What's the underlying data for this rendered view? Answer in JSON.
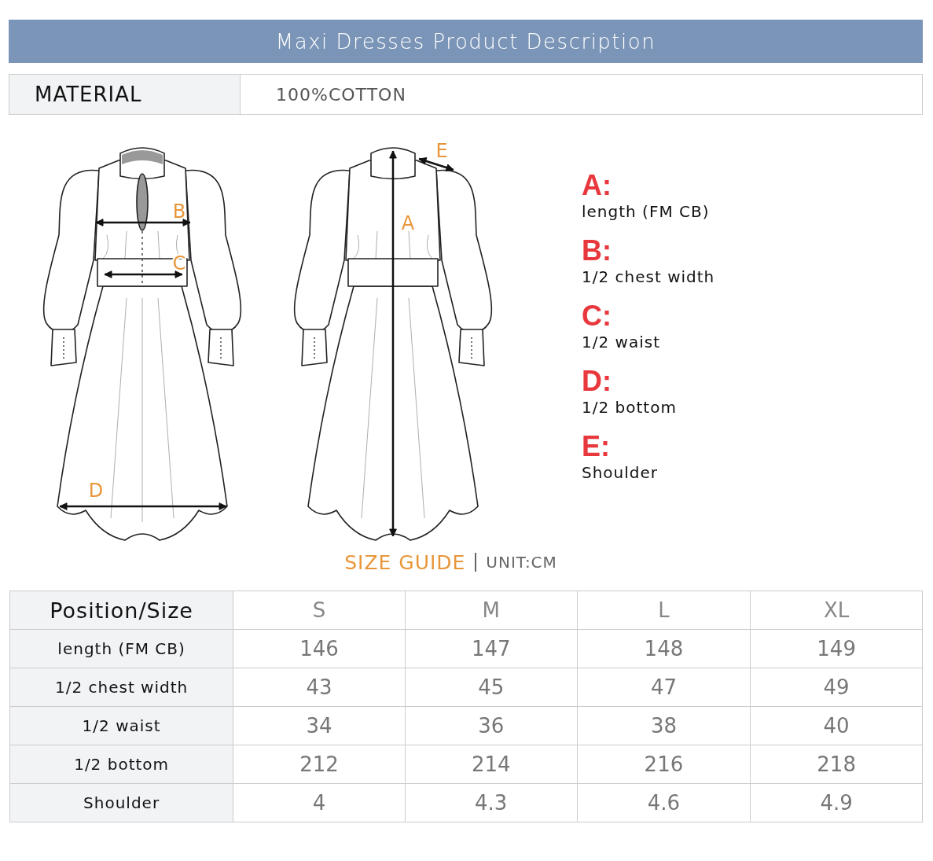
{
  "header": {
    "title": "Maxi Dresses Product Description"
  },
  "material": {
    "label": "MATERIAL",
    "value": "100%COTTON"
  },
  "diagram": {
    "labels": [
      "B",
      "C",
      "D",
      "A",
      "E"
    ]
  },
  "legend": [
    {
      "letter": "A:",
      "text": "length (FM CB)"
    },
    {
      "letter": "B:",
      "text": "1/2 chest width"
    },
    {
      "letter": "C:",
      "text": "1/2 waist"
    },
    {
      "letter": "D:",
      "text": "1/2 bottom"
    },
    {
      "letter": "E:",
      "text": "Shoulder"
    }
  ],
  "size_guide": {
    "title": "SIZE GUIDE",
    "unit": "UNIT:CM"
  },
  "table": {
    "columns": [
      "Position/Size",
      "S",
      "M",
      "L",
      "XL"
    ],
    "rows": [
      {
        "cells": [
          "length (FM CB)",
          "146",
          "147",
          "148",
          "149"
        ]
      },
      {
        "cells": [
          "1/2 chest width",
          "43",
          "45",
          "47",
          "49"
        ]
      },
      {
        "cells": [
          "1/2 waist",
          "34",
          "36",
          "38",
          "40"
        ]
      },
      {
        "cells": [
          "1/2 bottom",
          "212",
          "214",
          "216",
          "218"
        ]
      },
      {
        "cells": [
          "Shoulder",
          "4",
          "4.3",
          "4.6",
          "4.9"
        ]
      }
    ]
  }
}
